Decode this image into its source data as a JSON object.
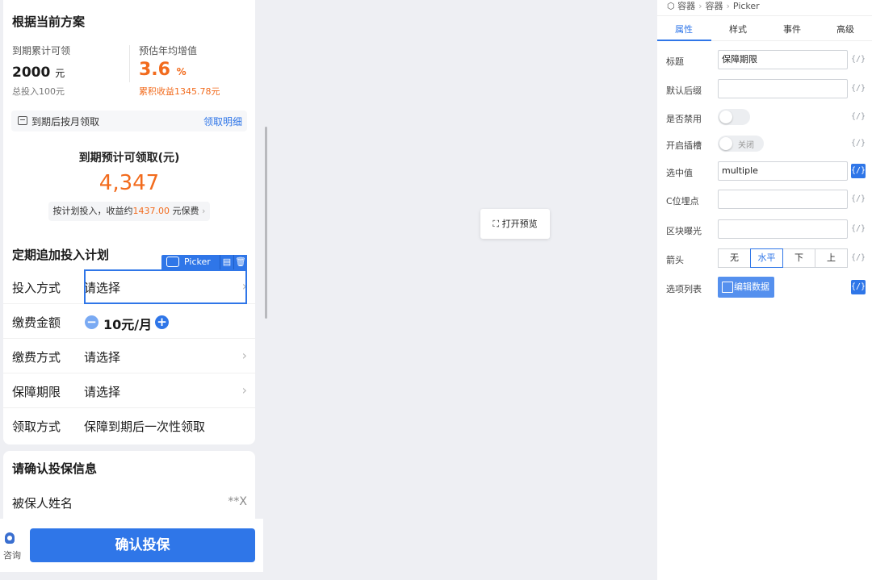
{
  "plan": {
    "title": "根据当前方案",
    "stat1": {
      "label": "到期累计可领",
      "value": "2000",
      "unit": "元",
      "sub": "总投入100元"
    },
    "stat2": {
      "label": "预估年均增值",
      "value": "3.6",
      "unit": "%",
      "sub": "累积收益1345.78元"
    },
    "monthly": {
      "label": "到期后按月领取",
      "link": "领取明细"
    },
    "expected_title": "到期预计可领取(元)",
    "expected_value": "4,347",
    "note_prefix": "按计划投入，收益约",
    "note_value": "1437.00",
    "note_suffix": "元保费",
    "note_chevron": "›"
  },
  "invest_plan": {
    "title": "定期追加投入计划",
    "picker_tag": "Picker",
    "rows": [
      {
        "key": "投入方式",
        "value": "请选择",
        "arrow": "›"
      },
      {
        "key": "缴费金额",
        "value": "10元/月"
      },
      {
        "key": "缴费方式",
        "value": "请选择",
        "arrow": "›"
      },
      {
        "key": "保障期限",
        "value": "请选择",
        "arrow": "›"
      },
      {
        "key": "领取方式",
        "value": "保障到期后一次性领取"
      }
    ],
    "minus": "−",
    "plus": "+"
  },
  "confirm_info": {
    "title": "请确认投保信息",
    "insured_label": "被保人姓名",
    "insured_value": "**X"
  },
  "footer": {
    "consult": "咨询",
    "confirm_button": "确认投保"
  },
  "canvas": {
    "preview_button": "⛶ 打开预览"
  },
  "panel": {
    "breadcrumb": [
      "容器",
      "容器",
      "Picker"
    ],
    "tabs": [
      "属性",
      "样式",
      "事件",
      "高级"
    ],
    "active_tab": "属性",
    "props": {
      "title_label": "标题",
      "title_value": "保障期限",
      "suffix_label": "默认后缀",
      "disabled_label": "是否禁用",
      "slot_label": "开启插槽",
      "slot_toggle_text": "关闭",
      "selected_label": "选中值",
      "selected_value": "multiple",
      "cposition_label": "C位埋点",
      "exposure_label": "区块曝光",
      "arrow_label": "箭头",
      "arrow_options": [
        "无",
        "水平",
        "下",
        "上"
      ],
      "arrow_selected": "水平",
      "options_label": "选项列表",
      "edit_data_button": "编辑数据",
      "expr": "{/}"
    }
  },
  "colors": {
    "accent": "#2f76e8",
    "orange": "#f26b1d"
  }
}
